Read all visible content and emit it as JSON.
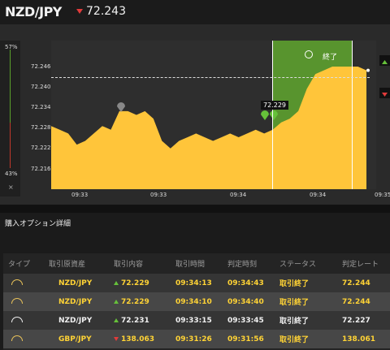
{
  "header": {
    "pair": "NZD/JPY",
    "price": "72.243"
  },
  "chart": {
    "percent_top": "57%",
    "percent_bottom": "43%",
    "close_mark": "×",
    "end_label": "終了",
    "tooltip": "72.229",
    "y_ticks": [
      "72.246",
      "72.240",
      "72.234",
      "72.228",
      "72.222",
      "72.216"
    ],
    "x_ticks": [
      "09:33",
      "09:33",
      "09:34",
      "09:34",
      "09:34",
      "09:35"
    ]
  },
  "chart_data": {
    "type": "area",
    "y_ticks": [
      72.246,
      72.24,
      72.234,
      72.228,
      72.222,
      72.216
    ],
    "ylim": [
      72.211,
      72.251
    ],
    "current_price": 72.243,
    "entry_price": 72.229,
    "values": [
      72.228,
      72.227,
      72.226,
      72.223,
      72.224,
      72.226,
      72.228,
      72.227,
      72.232,
      72.232,
      72.231,
      72.232,
      72.23,
      72.224,
      72.222,
      72.224,
      72.225,
      72.226,
      72.225,
      72.224,
      72.225,
      72.226,
      72.225,
      72.226,
      72.227,
      72.226,
      72.227,
      72.229,
      72.23,
      72.232,
      72.238,
      72.242,
      72.243,
      72.244,
      72.244,
      72.244,
      72.244,
      72.243
    ]
  },
  "section_title": "購入オプション詳細",
  "table": {
    "headers": [
      "タイプ",
      "取引原資産",
      "取引内容",
      "取引時間",
      "判定時刻",
      "ステータス",
      "判定レート"
    ],
    "rows": [
      {
        "asset": "NZD/JPY",
        "content": "72.229",
        "time": "09:34:13",
        "judge": "09:34:43",
        "status": "取引終了",
        "rate": "72.244"
      },
      {
        "asset": "NZD/JPY",
        "content": "72.229",
        "time": "09:34:10",
        "judge": "09:34:40",
        "status": "取引終了",
        "rate": "72.244"
      },
      {
        "asset": "NZD/JPY",
        "content": "72.231",
        "time": "09:33:15",
        "judge": "09:33:45",
        "status": "取引終了",
        "rate": "72.227"
      },
      {
        "asset": "GBP/JPY",
        "content": "138.063",
        "time": "09:31:26",
        "judge": "09:31:56",
        "status": "取引終了",
        "rate": "138.061"
      }
    ]
  },
  "colors": {
    "area": "#ffc53a",
    "win_zone": "#5b9a2e",
    "down": "#e23b3b",
    "up": "#66c13a",
    "highlight_text": "#ffd335"
  }
}
